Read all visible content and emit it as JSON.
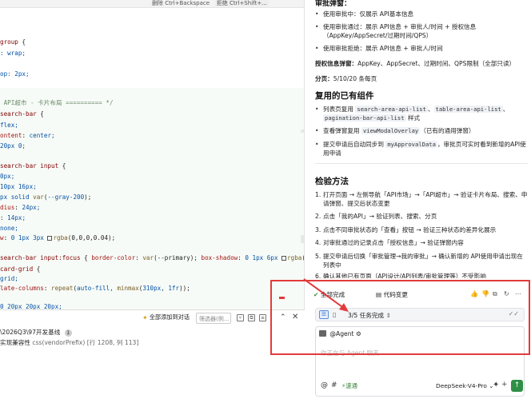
{
  "editor": {
    "topbar_hint": "删除 Ctrl+Backspace",
    "topbar_hint_right": "拒绝 Ctrl+Shift+...",
    "lines": [
      {
        "parts": [
          [
            "c-sel",
            "group "
          ],
          [
            "c-pl",
            "{"
          ]
        ]
      },
      {
        "parts": [
          [
            "c-val",
            ": wrap;"
          ]
        ]
      },
      {
        "parts": [
          [
            "c-val",
            "op: 2px;"
          ]
        ]
      },
      {
        "parts": [
          [
            "c-com",
            " API超市 - 卡片布局 ========== */"
          ]
        ]
      },
      {
        "parts": [
          [
            "c-sel",
            "search-bar "
          ],
          [
            "c-pl",
            "{"
          ]
        ]
      },
      {
        "parts": [
          [
            "c-val",
            "flex;"
          ]
        ]
      },
      {
        "parts": [
          [
            "c-prop",
            "ontent"
          ],
          [
            "c-pl",
            ": "
          ],
          [
            "c-val",
            "center;"
          ]
        ]
      },
      {
        "parts": [
          [
            "c-val",
            "20px 0;"
          ]
        ]
      },
      {
        "parts": [
          [
            "c-sel",
            "search-bar input "
          ],
          [
            "c-pl",
            "{"
          ]
        ]
      },
      {
        "parts": [
          [
            "c-val",
            "0px;"
          ]
        ]
      },
      {
        "parts": [
          [
            "c-val",
            "10px 16px;"
          ]
        ]
      },
      {
        "parts": [
          [
            "c-val",
            "px solid "
          ],
          [
            "c-fn",
            "var"
          ],
          [
            "c-pl",
            "("
          ],
          [
            "c-val",
            "--gray-200"
          ],
          [
            "c-pl",
            ");"
          ]
        ]
      },
      {
        "parts": [
          [
            "c-prop",
            "dius"
          ],
          [
            "c-pl",
            ": "
          ],
          [
            "c-val",
            "24px;"
          ]
        ]
      },
      {
        "parts": [
          [
            "c-pl",
            ": "
          ],
          [
            "c-val",
            "14px;"
          ]
        ]
      },
      {
        "parts": [
          [
            "c-val",
            "none;"
          ]
        ]
      },
      {
        "parts": [
          [
            "c-prop",
            "w"
          ],
          [
            "c-pl",
            ": "
          ],
          [
            "c-val",
            "0 1px 3px "
          ],
          [
            "box",
            ""
          ],
          [
            "c-fn",
            "rgba"
          ],
          [
            "c-pl",
            "(0,0,0,0.04);"
          ]
        ]
      },
      {
        "parts": [
          [
            "c-sel",
            "search-bar input:focus "
          ],
          [
            "c-pl",
            "{ "
          ],
          [
            "c-prop",
            "border-color"
          ],
          [
            "c-pl",
            ": "
          ],
          [
            "c-fn",
            "var"
          ],
          [
            "c-pl",
            "(--primary); "
          ],
          [
            "c-prop",
            "box-shadow"
          ],
          [
            "c-pl",
            ": "
          ],
          [
            "c-val",
            "0 1px 6px "
          ],
          [
            "box",
            ""
          ],
          [
            "c-fn",
            "rgba"
          ],
          [
            "c-pl",
            "(7"
          ]
        ]
      },
      {
        "parts": [
          [
            "c-sel",
            "card-grid "
          ],
          [
            "c-pl",
            "{"
          ]
        ]
      },
      {
        "parts": [
          [
            "c-val",
            "grid;"
          ]
        ]
      },
      {
        "parts": [
          [
            "c-prop",
            "late-columns"
          ],
          [
            "c-pl",
            ": "
          ],
          [
            "c-fn",
            "repeat"
          ],
          [
            "c-pl",
            "("
          ],
          [
            "c-val",
            "auto-fill, "
          ],
          [
            "c-fn",
            "minmax"
          ],
          [
            "c-pl",
            "("
          ],
          [
            "c-val",
            "310px, 1fr"
          ],
          [
            "c-pl",
            "));"
          ]
        ]
      },
      {
        "parts": [
          [
            "c-val",
            "0 20px 20px 20px;"
          ]
        ]
      }
    ]
  },
  "bottom_panel": {
    "add_all_label": "全部添加到对话",
    "filter_placeholder": "筛选器(例...",
    "problems": [
      {
        "text": "\\2026Q3\\97开发基线",
        "count": "1"
      },
      {
        "text": "实现兼容性",
        "source": "css(vendorPrefix)",
        "loc": "[行 1208, 列 113]"
      }
    ]
  },
  "docs": {
    "heading_cut": "审批弹窗：",
    "bullets_top": [
      "使用审批中：仅展示 API基本信息",
      "使用审批通过：展示 API信息 + 审批人/时间 + 授权信息（AppKey/AppSecret/过期时间/QPS）",
      "使用审批拒绝：展示 API信息 + 审批人/时间"
    ],
    "auth_label": "授权信息弹窗：",
    "auth_text": "AppKey、AppSecret、过期时间、QPS限制（全部只读）",
    "paging_label": "分页：",
    "paging_text": "5/10/20 条每页",
    "reuse_heading": "复用的已有组件",
    "reuse_bullets": [
      {
        "pre": "列表页复用 ",
        "codes": [
          "search-area-api-list",
          "table-area-api-list",
          "pagination-bar-api-list"
        ],
        "post": " 样式"
      },
      {
        "pre": "查看弹窗复用 ",
        "codes": [
          "viewModalOverlay"
        ],
        "post": "（已有的通用弹窗）"
      },
      {
        "pre": "提交申请后自动同步到 ",
        "codes": [
          "myApprovalData"
        ],
        "post": "，审批页可实时看到新增的API使用申请"
      }
    ],
    "verify_heading": "检验方法",
    "steps": [
      "打开页面 → 左侧导航「API市场」→「API超市」→ 验证卡片布局、搜索、申请弹窗、提交后状态变更",
      "点击「我的API」→ 验证列表、搜索、分页",
      "点击不同审批状态的「查看」按钮 → 验证三种状态的差异化展示",
      "对审批通过的记录点击「授权信息」→ 验证弹窗内容",
      "提交申请后切换「审批管理→我的审批」→ 确认新增的 API使用申请出现在列表中",
      "确认其他已有页面（API设计/API列表/审批管理等）不受影响"
    ]
  },
  "chat": {
    "accept_label": "全部完成",
    "code_change_label": "代码变更",
    "task_progress": "3/5 任务完成",
    "agent_label": "@Agent",
    "placeholder": "你正在与 Agent 聊天...",
    "speed_label": "速通",
    "model_label": "DeepSeek-V4-Pro"
  }
}
